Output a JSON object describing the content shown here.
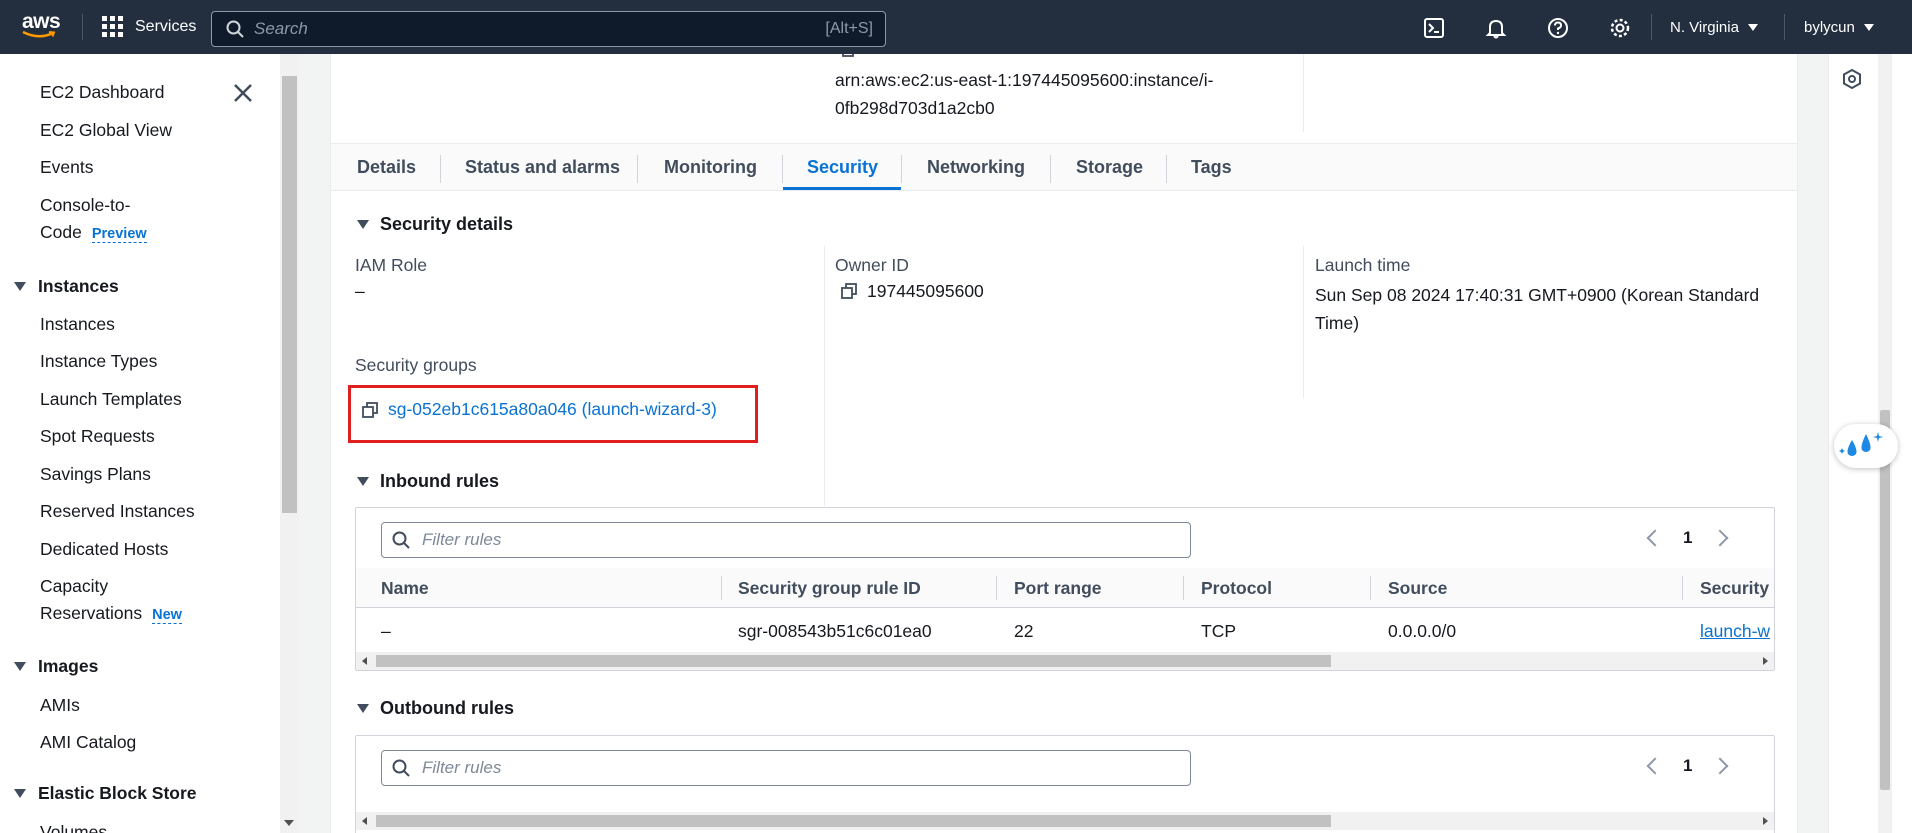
{
  "topnav": {
    "logo": "aws",
    "services_label": "Services",
    "search_placeholder": "Search",
    "search_shortcut": "[Alt+S]",
    "region": "N. Virginia",
    "user": "bylycun",
    "icons": [
      "cloudshell-icon",
      "bell-icon",
      "help-icon",
      "settings-icon"
    ]
  },
  "sidebar": {
    "items_top": [
      {
        "label": "EC2 Dashboard"
      },
      {
        "label": "EC2 Global View"
      },
      {
        "label": "Events"
      },
      {
        "label_line1": "Console-to-",
        "label_line2": "Code",
        "badge": "Preview"
      }
    ],
    "sections": [
      {
        "title": "Instances",
        "items": [
          "Instances",
          "Instance Types",
          "Launch Templates",
          "Spot Requests",
          "Savings Plans",
          "Reserved Instances",
          "Dedicated Hosts"
        ]
      },
      {
        "title": "Images",
        "items": [
          "AMIs",
          "AMI Catalog"
        ]
      },
      {
        "title": "Elastic Block Store",
        "items": [
          "Volumes"
        ]
      }
    ],
    "capacity": {
      "line1": "Capacity",
      "line2": "Reservations",
      "badge": "New"
    }
  },
  "instance": {
    "arn_line1": "arn:aws:ec2:us-east-1:197445095600:instance/i-",
    "arn_line2": "0fb298d703d1a2cb0"
  },
  "tabs": [
    "Details",
    "Status and alarms",
    "Monitoring",
    "Security",
    "Networking",
    "Storage",
    "Tags"
  ],
  "active_tab": "Security",
  "security_details": {
    "title": "Security details",
    "iam_role_label": "IAM Role",
    "iam_role_value": "–",
    "owner_id_label": "Owner ID",
    "owner_id_value": "197445095600",
    "launch_time_label": "Launch time",
    "launch_time_line1": "Sun Sep 08 2024 17:40:31 GMT+0900 (Korean Standard",
    "launch_time_line2": "Time)",
    "security_groups_label": "Security groups",
    "security_group_link": "sg-052eb1c615a80a046 (launch-wizard-3)"
  },
  "inbound": {
    "title": "Inbound rules",
    "filter_placeholder": "Filter rules",
    "page": "1",
    "columns": [
      "Name",
      "Security group rule ID",
      "Port range",
      "Protocol",
      "Source",
      "Security"
    ],
    "rows": [
      {
        "name": "–",
        "rule_id": "sgr-008543b51c6c01ea0",
        "port_range": "22",
        "protocol": "TCP",
        "source": "0.0.0.0/0",
        "security": "launch-w"
      }
    ]
  },
  "outbound": {
    "title": "Outbound rules",
    "filter_placeholder": "Filter rules",
    "page": "1"
  }
}
